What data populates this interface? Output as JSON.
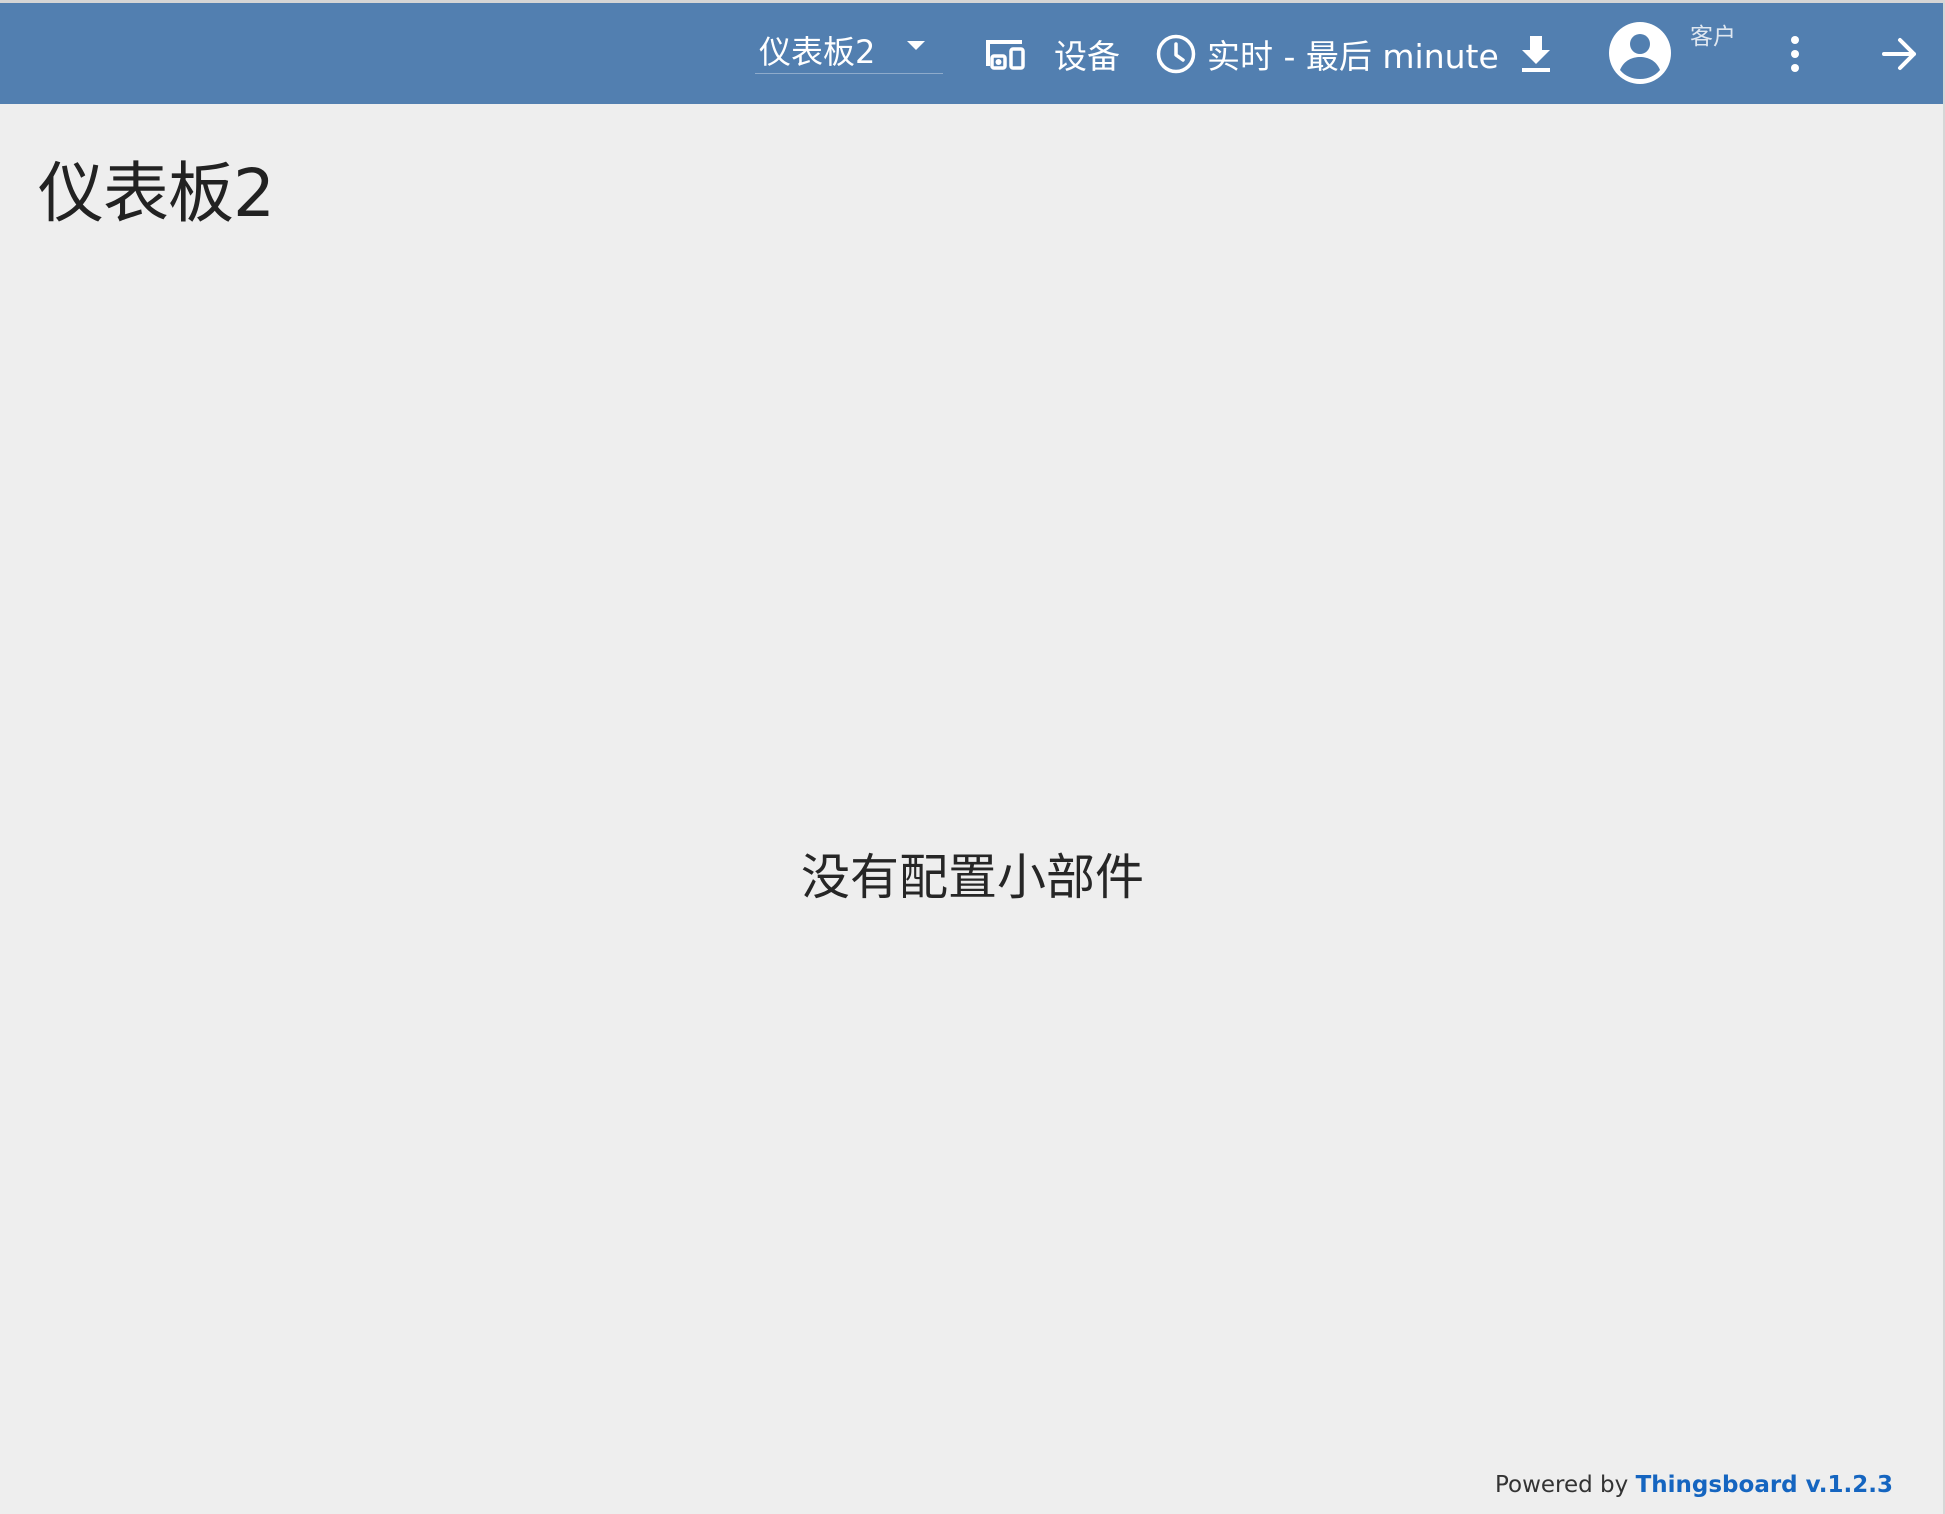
{
  "toolbar": {
    "dashboard_select": "仪表板2",
    "devices_label": "设备",
    "timewindow_label": "实时 - 最后 minute",
    "user_role": "客户",
    "bg_color": "#527fb0"
  },
  "main": {
    "title": "仪表板2",
    "empty_message": "没有配置小部件"
  },
  "footer": {
    "prefix": "Powered by",
    "brand": "Thingsboard v.1.2.3",
    "brand_color": "#1565c0"
  },
  "icons": {
    "devices": "devices-icon",
    "clock": "clock-icon",
    "download": "download-icon",
    "avatar": "account-circle-icon",
    "menu": "more-vert-icon",
    "exit": "arrow-forward-icon",
    "dropdown": "caret-down-icon"
  }
}
